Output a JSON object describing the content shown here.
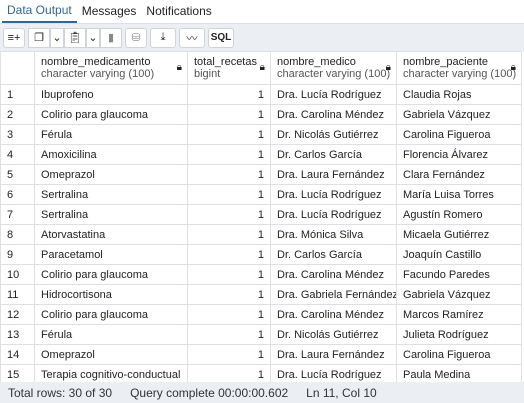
{
  "tabs": [
    "Data Output",
    "Messages",
    "Notifications"
  ],
  "toolbar": {
    "sql_label": "SQL"
  },
  "columns": [
    {
      "name": "nombre_medicamento",
      "type": "character varying (100)"
    },
    {
      "name": "total_recetas",
      "type": "bigint"
    },
    {
      "name": "nombre_medico",
      "type": "character varying (100)"
    },
    {
      "name": "nombre_paciente",
      "type": "character varying (100)"
    }
  ],
  "rows": [
    [
      "1",
      "Ibuprofeno",
      "1",
      "Dra. Lucía Rodríguez",
      "Claudia Rojas"
    ],
    [
      "2",
      "Colirio para glaucoma",
      "1",
      "Dra. Carolina Méndez",
      "Gabriela Vázquez"
    ],
    [
      "3",
      "Férula",
      "1",
      "Dr. Nicolás Gutiérrez",
      "Carolina Figueroa"
    ],
    [
      "4",
      "Amoxicilina",
      "1",
      "Dr. Carlos García",
      "Florencia Álvarez"
    ],
    [
      "5",
      "Omeprazol",
      "1",
      "Dra. Laura Fernández",
      "Clara Fernández"
    ],
    [
      "6",
      "Sertralina",
      "1",
      "Dra. Lucía Rodríguez",
      "María Luisa Torres"
    ],
    [
      "7",
      "Sertralina",
      "1",
      "Dra. Lucía Rodríguez",
      "Agustín Romero"
    ],
    [
      "8",
      "Atorvastatina",
      "1",
      "Dra. Mónica Silva",
      "Micaela Gutiérrez"
    ],
    [
      "9",
      "Paracetamol",
      "1",
      "Dr. Carlos García",
      "Joaquín Castillo"
    ],
    [
      "10",
      "Colirio para glaucoma",
      "1",
      "Dra. Carolina Méndez",
      "Facundo Paredes"
    ],
    [
      "11",
      "Hidrocortisona",
      "1",
      "Dra. Gabriela Fernández",
      "Gabriela Vázquez"
    ],
    [
      "12",
      "Colirio para glaucoma",
      "1",
      "Dra. Carolina Méndez",
      "Marcos Ramírez"
    ],
    [
      "13",
      "Férula",
      "1",
      "Dr. Nicolás Gutiérrez",
      "Julieta Rodríguez"
    ],
    [
      "14",
      "Omeprazol",
      "1",
      "Dra. Laura Fernández",
      "Carolina Figueroa"
    ],
    [
      "15",
      "Terapia cognitivo-conductual",
      "1",
      "Dra. Lucía Rodríguez",
      "Paula Medina"
    ]
  ],
  "status": {
    "total": "Total rows: 30 of 30",
    "query": "Query complete 00:00:00.602",
    "pos": "Ln 11, Col 10"
  }
}
